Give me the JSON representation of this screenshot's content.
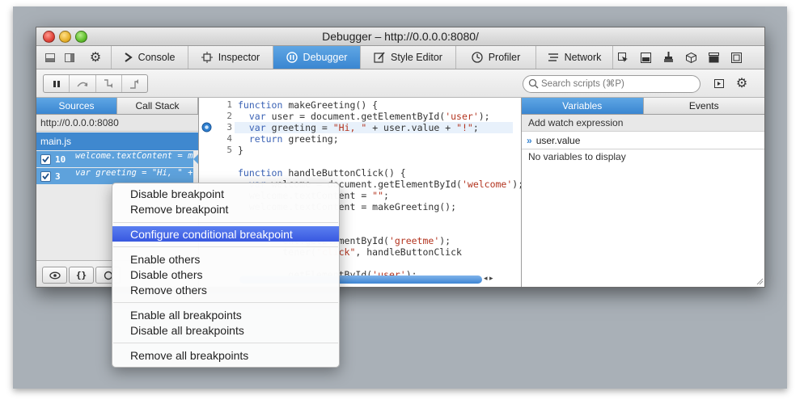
{
  "window": {
    "title": "Debugger – http://0.0.0.0:8080/"
  },
  "devtools_tabs": [
    {
      "label": "Console",
      "icon": "console-chevron-icon"
    },
    {
      "label": "Inspector",
      "icon": "inspector-icon"
    },
    {
      "label": "Debugger",
      "icon": "debugger-icon",
      "active": true
    },
    {
      "label": "Style Editor",
      "icon": "style-editor-icon"
    },
    {
      "label": "Profiler",
      "icon": "profiler-icon"
    },
    {
      "label": "Network",
      "icon": "network-icon"
    }
  ],
  "search": {
    "placeholder": "Search scripts (⌘P)"
  },
  "left_panel": {
    "tabs": [
      {
        "label": "Sources",
        "active": true
      },
      {
        "label": "Call Stack"
      }
    ],
    "source_url": "http://0.0.0.0:8080",
    "file": "main.js",
    "breakpoints": [
      {
        "line": "10",
        "code": "welcome.textContent = ma…",
        "checked": true
      },
      {
        "line": "3",
        "code": "var greeting = \"Hi, \" + u…",
        "checked": true
      }
    ],
    "bottom_buttons": [
      "{}"
    ]
  },
  "editor": {
    "gutter_lines": [
      "1",
      "2",
      "3",
      "4",
      "5"
    ],
    "lines": [
      "function makeGreeting() {",
      "  var user = document.getElementById('user');",
      "  var greeting = \"Hi, \" + user.value + \"!\";",
      "  return greeting;",
      "}",
      "",
      "function handleButtonClick() {",
      "  var welcome = document.getElementById('welcome');",
      "  welcome.textContent = \"\";",
      "  welcome.textContent = makeGreeting();",
      "",
      "",
      "        ent.getElementById('greetme');",
      "        tener(\"click\", handleButtonClick",
      "",
      "        .getElementById('user');"
    ]
  },
  "right_panel": {
    "tabs": [
      {
        "label": "Variables",
        "active": true
      },
      {
        "label": "Events"
      }
    ],
    "watch_placeholder": "Add watch expression",
    "watch_expression": "user.value",
    "empty_message": "No variables to display"
  },
  "context_menu": {
    "items": [
      "Disable breakpoint",
      "Remove breakpoint",
      "Configure conditional breakpoint",
      "Enable others",
      "Disable others",
      "Remove others",
      "Enable all breakpoints",
      "Disable all breakpoints",
      "Remove all breakpoints"
    ],
    "selected": "Configure conditional breakpoint"
  },
  "colors": {
    "accent": "#3a86d1",
    "menu_highlight": "#3858e0",
    "keyword": "#3a62b5",
    "string": "#b3341f"
  }
}
